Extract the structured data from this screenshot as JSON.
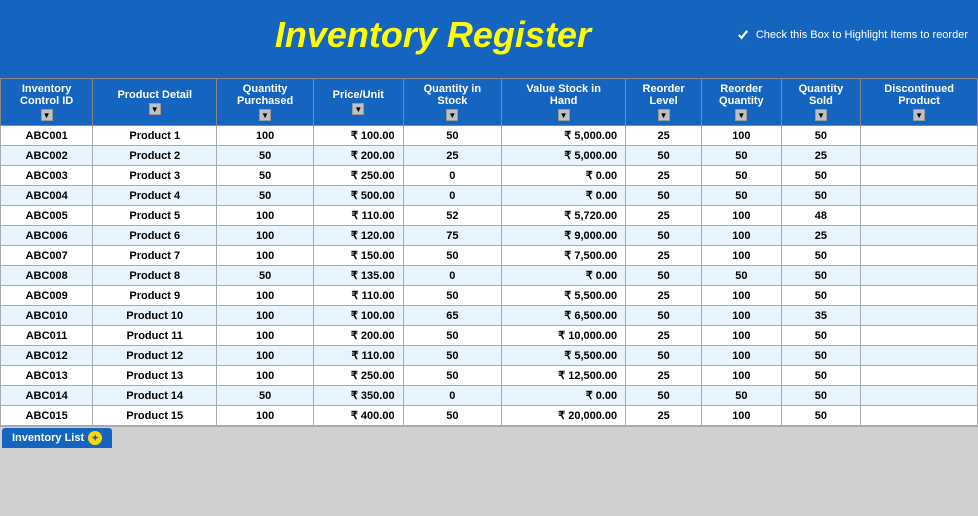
{
  "header": {
    "title": "Inventory Register",
    "checkbox_label": "Check this Box to Highlight Items to reorder",
    "checkbox_checked": true
  },
  "columns": [
    {
      "id": "control_id",
      "label": "Inventory Control ID"
    },
    {
      "id": "product_detail",
      "label": "Product Detail"
    },
    {
      "id": "qty_purchased",
      "label": "Quantity Purchased"
    },
    {
      "id": "price_unit",
      "label": "Price/Unit"
    },
    {
      "id": "qty_stock",
      "label": "Quantity in Stock"
    },
    {
      "id": "value_stock",
      "label": "Value Stock in Hand"
    },
    {
      "id": "reorder_level",
      "label": "Reorder Level"
    },
    {
      "id": "reorder_qty",
      "label": "Reorder Quantity"
    },
    {
      "id": "qty_sold",
      "label": "Quantity Sold"
    },
    {
      "id": "discontinued",
      "label": "Discontinued Product"
    }
  ],
  "rows": [
    {
      "control_id": "ABC001",
      "product_detail": "Product 1",
      "qty_purchased": "100",
      "price_unit": "₹ 100.00",
      "qty_stock": "50",
      "value_stock": "₹ 5,000.00",
      "reorder_level": "25",
      "reorder_qty": "100",
      "qty_sold": "50",
      "discontinued": ""
    },
    {
      "control_id": "ABC002",
      "product_detail": "Product 2",
      "qty_purchased": "50",
      "price_unit": "₹ 200.00",
      "qty_stock": "25",
      "value_stock": "₹ 5,000.00",
      "reorder_level": "50",
      "reorder_qty": "50",
      "qty_sold": "25",
      "discontinued": ""
    },
    {
      "control_id": "ABC003",
      "product_detail": "Product 3",
      "qty_purchased": "50",
      "price_unit": "₹ 250.00",
      "qty_stock": "0",
      "value_stock": "₹ 0.00",
      "reorder_level": "25",
      "reorder_qty": "50",
      "qty_sold": "50",
      "discontinued": ""
    },
    {
      "control_id": "ABC004",
      "product_detail": "Product 4",
      "qty_purchased": "50",
      "price_unit": "₹ 500.00",
      "qty_stock": "0",
      "value_stock": "₹ 0.00",
      "reorder_level": "50",
      "reorder_qty": "50",
      "qty_sold": "50",
      "discontinued": ""
    },
    {
      "control_id": "ABC005",
      "product_detail": "Product 5",
      "qty_purchased": "100",
      "price_unit": "₹ 110.00",
      "qty_stock": "52",
      "value_stock": "₹ 5,720.00",
      "reorder_level": "25",
      "reorder_qty": "100",
      "qty_sold": "48",
      "discontinued": ""
    },
    {
      "control_id": "ABC006",
      "product_detail": "Product 6",
      "qty_purchased": "100",
      "price_unit": "₹ 120.00",
      "qty_stock": "75",
      "value_stock": "₹ 9,000.00",
      "reorder_level": "50",
      "reorder_qty": "100",
      "qty_sold": "25",
      "discontinued": ""
    },
    {
      "control_id": "ABC007",
      "product_detail": "Product 7",
      "qty_purchased": "100",
      "price_unit": "₹ 150.00",
      "qty_stock": "50",
      "value_stock": "₹ 7,500.00",
      "reorder_level": "25",
      "reorder_qty": "100",
      "qty_sold": "50",
      "discontinued": ""
    },
    {
      "control_id": "ABC008",
      "product_detail": "Product 8",
      "qty_purchased": "50",
      "price_unit": "₹ 135.00",
      "qty_stock": "0",
      "value_stock": "₹ 0.00",
      "reorder_level": "50",
      "reorder_qty": "50",
      "qty_sold": "50",
      "discontinued": ""
    },
    {
      "control_id": "ABC009",
      "product_detail": "Product 9",
      "qty_purchased": "100",
      "price_unit": "₹ 110.00",
      "qty_stock": "50",
      "value_stock": "₹ 5,500.00",
      "reorder_level": "25",
      "reorder_qty": "100",
      "qty_sold": "50",
      "discontinued": ""
    },
    {
      "control_id": "ABC010",
      "product_detail": "Product 10",
      "qty_purchased": "100",
      "price_unit": "₹ 100.00",
      "qty_stock": "65",
      "value_stock": "₹ 6,500.00",
      "reorder_level": "50",
      "reorder_qty": "100",
      "qty_sold": "35",
      "discontinued": ""
    },
    {
      "control_id": "ABC011",
      "product_detail": "Product 11",
      "qty_purchased": "100",
      "price_unit": "₹ 200.00",
      "qty_stock": "50",
      "value_stock": "₹ 10,000.00",
      "reorder_level": "25",
      "reorder_qty": "100",
      "qty_sold": "50",
      "discontinued": ""
    },
    {
      "control_id": "ABC012",
      "product_detail": "Product 12",
      "qty_purchased": "100",
      "price_unit": "₹ 110.00",
      "qty_stock": "50",
      "value_stock": "₹ 5,500.00",
      "reorder_level": "50",
      "reorder_qty": "100",
      "qty_sold": "50",
      "discontinued": ""
    },
    {
      "control_id": "ABC013",
      "product_detail": "Product 13",
      "qty_purchased": "100",
      "price_unit": "₹ 250.00",
      "qty_stock": "50",
      "value_stock": "₹ 12,500.00",
      "reorder_level": "25",
      "reorder_qty": "100",
      "qty_sold": "50",
      "discontinued": ""
    },
    {
      "control_id": "ABC014",
      "product_detail": "Product 14",
      "qty_purchased": "50",
      "price_unit": "₹ 350.00",
      "qty_stock": "0",
      "value_stock": "₹ 0.00",
      "reorder_level": "50",
      "reorder_qty": "50",
      "qty_sold": "50",
      "discontinued": ""
    },
    {
      "control_id": "ABC015",
      "product_detail": "Product 15",
      "qty_purchased": "100",
      "price_unit": "₹ 400.00",
      "qty_stock": "50",
      "value_stock": "₹ 20,000.00",
      "reorder_level": "25",
      "reorder_qty": "100",
      "qty_sold": "50",
      "discontinued": ""
    }
  ],
  "tab": {
    "label": "Inventory List"
  }
}
